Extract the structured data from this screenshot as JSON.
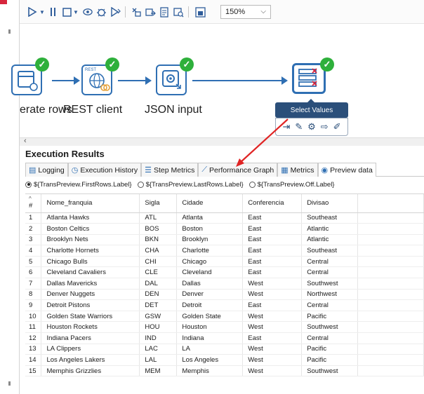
{
  "toolbar": {
    "zoom_value": "150%"
  },
  "canvas": {
    "steps": [
      {
        "label": "erate rows"
      },
      {
        "label": "REST client",
        "badge": "REST"
      },
      {
        "label": "JSON input"
      },
      {
        "label": "Select Values"
      }
    ],
    "tooltip": "Select Values"
  },
  "results": {
    "title": "Execution Results",
    "tabs": [
      {
        "label": "Logging",
        "icon": "document-icon"
      },
      {
        "label": "Execution History",
        "icon": "history-icon"
      },
      {
        "label": "Step Metrics",
        "icon": "list-icon"
      },
      {
        "label": "Performance Graph",
        "icon": "graph-icon"
      },
      {
        "label": "Metrics",
        "icon": "metrics-icon"
      },
      {
        "label": "Preview data",
        "icon": "eye-icon"
      }
    ],
    "radio_options": [
      {
        "label": "${TransPreview.FirstRows.Label}",
        "selected": true
      },
      {
        "label": "${TransPreview.LastRows.Label}",
        "selected": false
      },
      {
        "label": "${TransPreview.Off.Label}",
        "selected": false
      }
    ],
    "columns": [
      "#",
      "Nome_franquia",
      "Sigla",
      "Cidade",
      "Conferencia",
      "Divisao"
    ],
    "rows": [
      [
        "1",
        "Atlanta Hawks",
        "ATL",
        "Atlanta",
        "East",
        "Southeast"
      ],
      [
        "2",
        "Boston Celtics",
        "BOS",
        "Boston",
        "East",
        "Atlantic"
      ],
      [
        "3",
        "Brooklyn Nets",
        "BKN",
        "Brooklyn",
        "East",
        "Atlantic"
      ],
      [
        "4",
        "Charlotte Hornets",
        "CHA",
        "Charlotte",
        "East",
        "Southeast"
      ],
      [
        "5",
        "Chicago Bulls",
        "CHI",
        "Chicago",
        "East",
        "Central"
      ],
      [
        "6",
        "Cleveland Cavaliers",
        "CLE",
        "Cleveland",
        "East",
        "Central"
      ],
      [
        "7",
        "Dallas Mavericks",
        "DAL",
        "Dallas",
        "West",
        "Southwest"
      ],
      [
        "8",
        "Denver Nuggets",
        "DEN",
        "Denver",
        "West",
        "Northwest"
      ],
      [
        "9",
        "Detroit Pistons",
        "DET",
        "Detroit",
        "East",
        "Central"
      ],
      [
        "10",
        "Golden State Warriors",
        "GSW",
        "Golden State",
        "West",
        "Pacific"
      ],
      [
        "11",
        "Houston Rockets",
        "HOU",
        "Houston",
        "West",
        "Southwest"
      ],
      [
        "12",
        "Indiana Pacers",
        "IND",
        "Indiana",
        "East",
        "Central"
      ],
      [
        "13",
        "LA Clippers",
        "LAC",
        "LA",
        "West",
        "Pacific"
      ],
      [
        "14",
        "Los Angeles Lakers",
        "LAL",
        "Los Angeles",
        "West",
        "Pacific"
      ],
      [
        "15",
        "Memphis Grizzlies",
        "MEM",
        "Memphis",
        "West",
        "Southwest"
      ]
    ]
  },
  "colors": {
    "accent": "#2f6fb3",
    "success": "#2eb03b",
    "annotation_arrow": "#e02424"
  }
}
